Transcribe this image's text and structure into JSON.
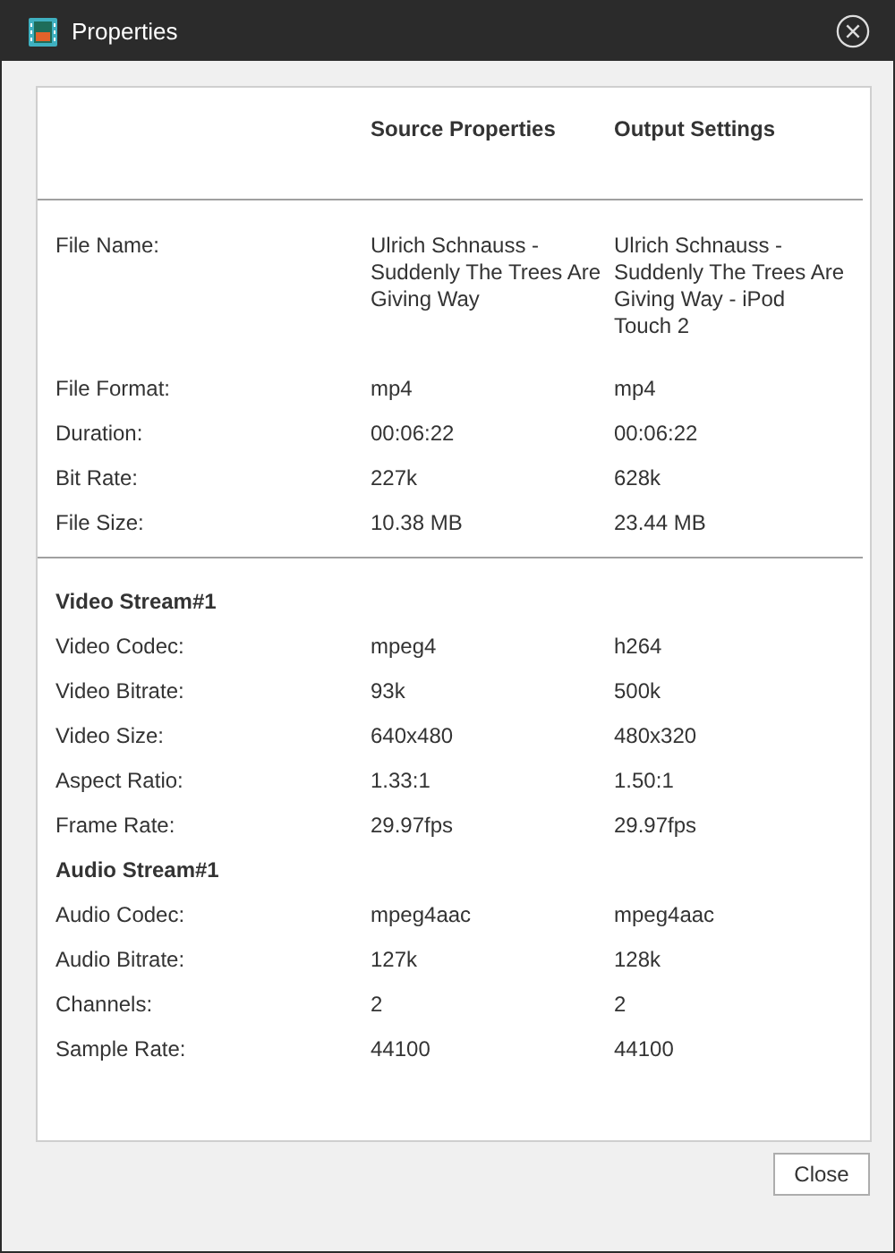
{
  "window": {
    "title": "Properties"
  },
  "columns": [
    "Source Properties",
    "Output Settings"
  ],
  "sections": [
    {
      "rows": [
        {
          "kind": "field",
          "label": "File Name:",
          "source": "Ulrich Schnauss - Suddenly The Trees Are Giving Way",
          "output": "Ulrich Schnauss - Suddenly The Trees Are Giving Way - iPod Touch 2"
        },
        {
          "kind": "field",
          "label": "File Format:",
          "source": "mp4",
          "output": "mp4"
        },
        {
          "kind": "field",
          "label": "Duration:",
          "source": "00:06:22",
          "output": "00:06:22"
        },
        {
          "kind": "field",
          "label": "Bit Rate:",
          "source": "227k",
          "output": "628k"
        },
        {
          "kind": "field",
          "label": "File Size:",
          "source": "10.38 MB",
          "output": "23.44 MB"
        }
      ]
    },
    {
      "rows": [
        {
          "kind": "heading",
          "label": "Video Stream#1"
        },
        {
          "kind": "field",
          "label": "Video Codec:",
          "source": "mpeg4",
          "output": "h264"
        },
        {
          "kind": "field",
          "label": "Video Bitrate:",
          "source": "93k",
          "output": "500k"
        },
        {
          "kind": "field",
          "label": "Video Size:",
          "source": "640x480",
          "output": "480x320"
        },
        {
          "kind": "field",
          "label": "Aspect Ratio:",
          "source": "1.33:1",
          "output": "1.50:1"
        },
        {
          "kind": "field",
          "label": "Frame Rate:",
          "source": "29.97fps",
          "output": "29.97fps"
        },
        {
          "kind": "heading",
          "label": "Audio Stream#1"
        },
        {
          "kind": "field",
          "label": "Audio Codec:",
          "source": "mpeg4aac",
          "output": "mpeg4aac"
        },
        {
          "kind": "field",
          "label": "Audio Bitrate:",
          "source": "127k",
          "output": "128k"
        },
        {
          "kind": "field",
          "label": "Channels:",
          "source": "2",
          "output": "2"
        },
        {
          "kind": "field",
          "label": "Sample Rate:",
          "source": "44100",
          "output": "44100"
        }
      ]
    }
  ],
  "buttons": [
    "Close"
  ]
}
